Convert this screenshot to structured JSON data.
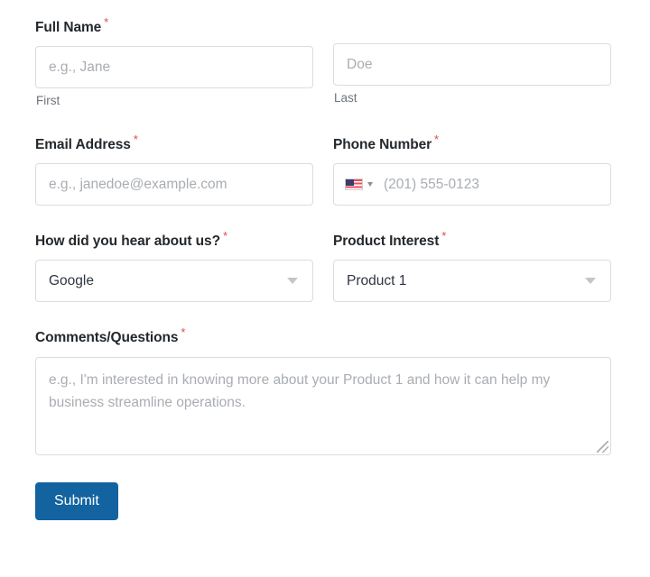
{
  "form": {
    "required_marker": "*",
    "accent_color": "#1263a0",
    "required_color": "#e2484d",
    "border_color": "#dcdcdc",
    "placeholder_color": "#a9adb2",
    "fields": {
      "full_name": {
        "label": "Full Name",
        "first": {
          "placeholder": "e.g., Jane",
          "value": "",
          "sublabel": "First"
        },
        "last": {
          "placeholder": "Doe",
          "value": "",
          "sublabel": "Last"
        }
      },
      "email": {
        "label": "Email Address",
        "placeholder": "e.g., janedoe@example.com",
        "value": ""
      },
      "phone": {
        "label": "Phone Number",
        "placeholder": "(201) 555-0123",
        "value": "",
        "country_flag": "us-flag-icon",
        "country_selector": "country-code-dropdown"
      },
      "referral": {
        "label": "How did you hear about us?",
        "value": "Google"
      },
      "product_interest": {
        "label": "Product Interest",
        "value": "Product 1"
      },
      "comments": {
        "label": "Comments/Questions",
        "placeholder": "e.g., I'm interested in knowing more about your Product 1 and how it can help my business streamline operations.",
        "value": ""
      }
    },
    "submit": {
      "label": "Submit"
    }
  }
}
